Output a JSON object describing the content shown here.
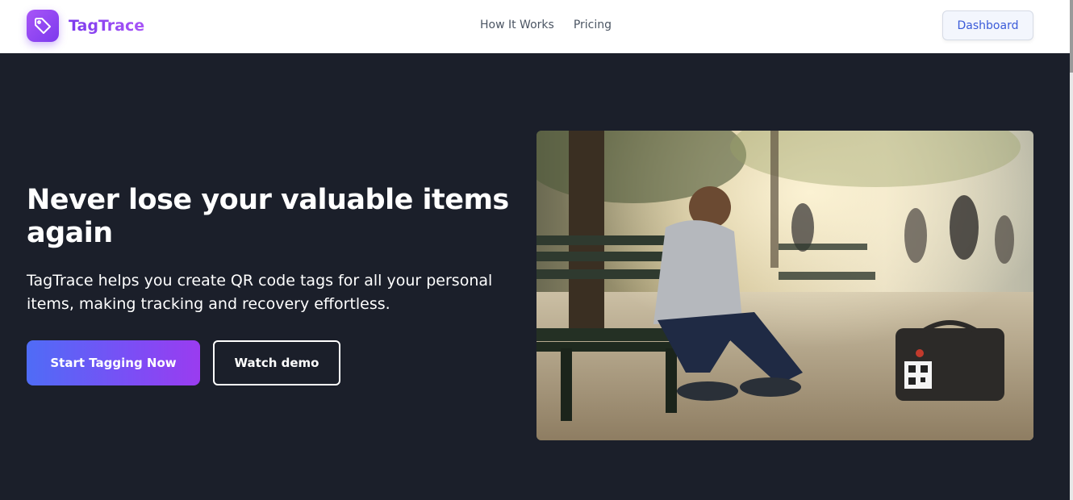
{
  "brand": {
    "name": "TagTrace",
    "logo_icon": "tag-icon"
  },
  "nav": {
    "links": [
      {
        "label": "How It Works"
      },
      {
        "label": "Pricing"
      }
    ],
    "dashboard_label": "Dashboard"
  },
  "hero": {
    "title": "Never lose your valuable items again",
    "subtitle": "TagTrace helps you create QR code tags for all your personal items, making tracking and recovery effortless.",
    "primary_cta": "Start Tagging Now",
    "secondary_cta": "Watch demo",
    "image": "photo-man-on-bench-with-qr-tagged-bag"
  },
  "colors": {
    "accent": "#7c3aed",
    "hero_bg": "#1b1f2a",
    "link_blue": "#3b5bd9"
  }
}
